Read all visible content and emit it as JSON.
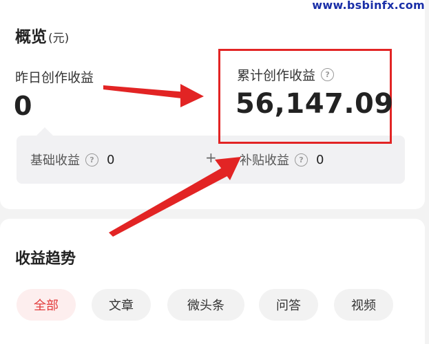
{
  "watermark": "www.bsbinfx.com",
  "overview": {
    "title": "概览",
    "unit": "(元)",
    "yesterday_label": "昨日创作收益",
    "yesterday_value": "0",
    "cumulative_label": "累计创作收益",
    "cumulative_value": "56,147.09",
    "basic_label": "基础收益",
    "basic_value": "0",
    "plus": "+",
    "subsidy_label": "补贴收益",
    "subsidy_value": "0"
  },
  "trend": {
    "title": "收益趋势",
    "chips": [
      {
        "label": "全部",
        "active": true
      },
      {
        "label": "文章",
        "active": false
      },
      {
        "label": "微头条",
        "active": false
      },
      {
        "label": "问答",
        "active": false
      },
      {
        "label": "视频",
        "active": false
      }
    ]
  },
  "colors": {
    "highlight_red": "#e22424",
    "active_chip_text": "#e23b3b",
    "active_chip_bg": "#fdeeee",
    "watermark_blue": "#1a2fa8"
  },
  "icons": {
    "help": "question-circle-icon"
  }
}
